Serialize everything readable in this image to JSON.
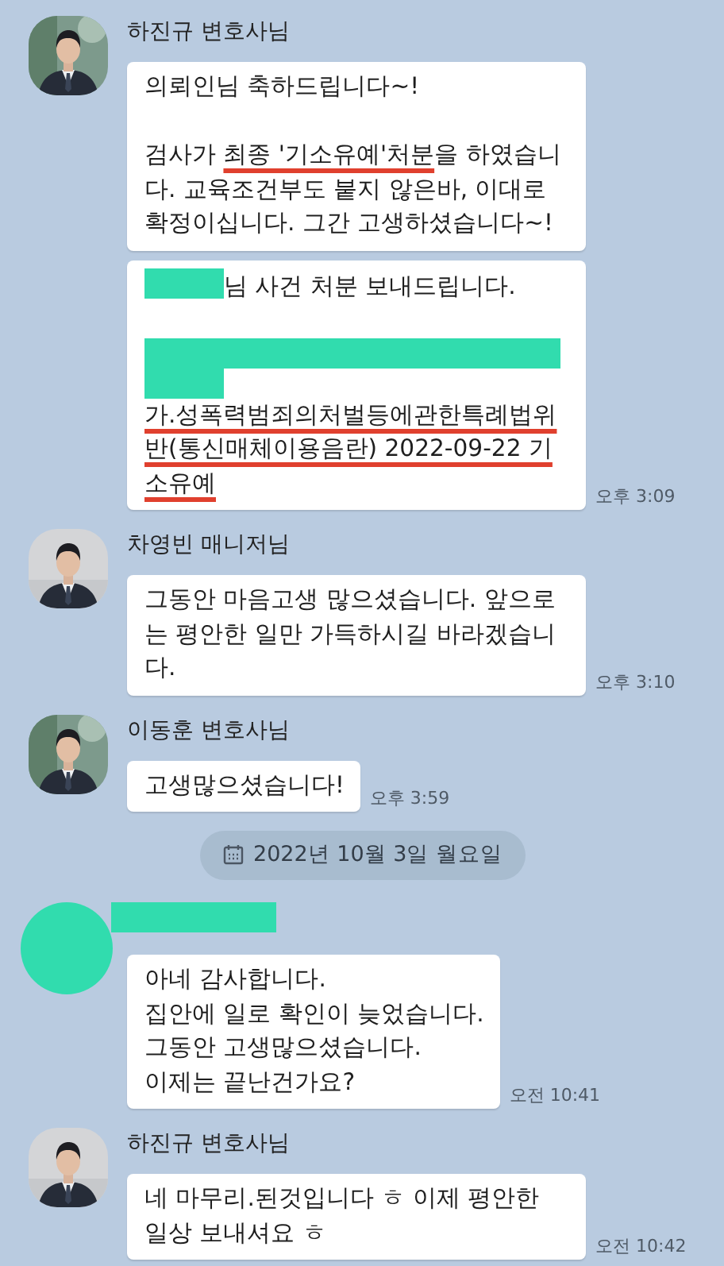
{
  "chat": [
    {
      "kind": "group",
      "sender": {
        "kind": "name",
        "name": "하진규 변호사님"
      },
      "avatar": {
        "kind": "picture"
      },
      "messages": [
        {
          "blocks": [
            {
              "segments": [
                {
                  "kind": "text",
                  "text": "의뢰인님 축하드립니다~!"
                }
              ]
            },
            {
              "segments": [
                {
                  "kind": "text",
                  "text": "검사가 "
                },
                {
                  "kind": "text",
                  "text": "최종 '기소유예'처분",
                  "underlined": true
                },
                {
                  "kind": "text",
                  "text": "을 하였습니다. 교육조건부도 붙지 않은바, 이대로 확정이십니다. 그간 고생하셨습니다~!"
                }
              ]
            }
          ]
        },
        {
          "blocks": [
            {
              "segments": [
                {
                  "kind": "redaction"
                },
                {
                  "kind": "text",
                  "text": "님 사건 처분 보내드립니다."
                }
              ]
            },
            {
              "segments": [
                {
                  "kind": "redaction-lines"
                },
                {
                  "kind": "text",
                  "text": "가.성폭력범죄의처벌등에관한특례법위반(통신매체이용음란)  2022-09-22 기소유예",
                  "underlined": true
                }
              ]
            }
          ],
          "time": "오후 3:09"
        }
      ]
    },
    {
      "kind": "group",
      "sender": {
        "kind": "name",
        "name": "차영빈 매니저님"
      },
      "avatar": {
        "kind": "picture"
      },
      "messages": [
        {
          "blocks": [
            {
              "segments": [
                {
                  "kind": "text",
                  "text": "그동안 마음고생 많으셨습니다. 앞으로는 평안한 일만 가득하시길 바라겠습니다."
                }
              ]
            }
          ],
          "time": "오후 3:10"
        }
      ]
    },
    {
      "kind": "group",
      "sender": {
        "kind": "name",
        "name": "이동훈 변호사님"
      },
      "avatar": {
        "kind": "picture"
      },
      "messages": [
        {
          "blocks": [
            {
              "segments": [
                {
                  "kind": "text",
                  "text": "고생많으셨습니다!"
                }
              ]
            }
          ],
          "time": "오후 3:59"
        }
      ]
    },
    {
      "kind": "date",
      "text": "2022년 10월 3일 월요일"
    },
    {
      "kind": "group",
      "sender": {
        "kind": "redacted"
      },
      "avatar": {
        "kind": "redacted"
      },
      "messages": [
        {
          "blocks": [
            {
              "segments": [
                {
                  "kind": "text",
                  "text": "아네 감사합니다.\n집안에 일로 확인이 늦었습니다.\n그동안 고생많으셨습니다.\n이제는 끝난건가요?"
                }
              ]
            }
          ],
          "time": "오전 10:41"
        }
      ]
    },
    {
      "kind": "group",
      "sender": {
        "kind": "name",
        "name": "하진규 변호사님"
      },
      "avatar": {
        "kind": "picture"
      },
      "messages": [
        {
          "blocks": [
            {
              "segments": [
                {
                  "kind": "text",
                  "text": "네 마무리.된것입니다 ㅎ 이제 평안한 일상 보내셔요 ㅎ"
                }
              ]
            }
          ],
          "time": "오전 10:42"
        }
      ]
    }
  ]
}
